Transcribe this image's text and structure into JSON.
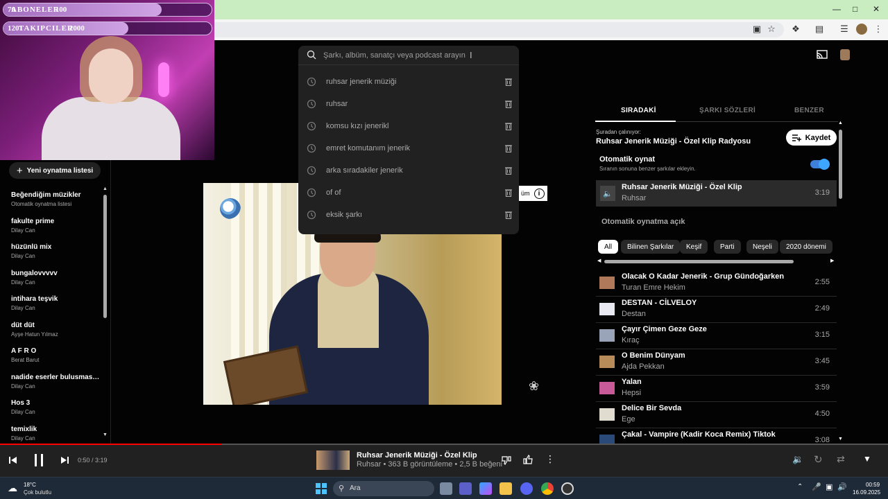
{
  "overlay": {
    "bars": [
      {
        "left": "76",
        "label": "ABONELER",
        "right": "100",
        "progress": 0.76
      },
      {
        "left": "1201",
        "label": "TAKIPCILER",
        "right": "2000",
        "progress": 0.6
      }
    ]
  },
  "sidebar": {
    "new_playlist_label": "Yeni oynatma listesi",
    "items": [
      {
        "title": "Beğendiğim müzikler",
        "subtitle": "Otomatik oynatma listesi"
      },
      {
        "title": "fakulte prime",
        "subtitle": "Dilay Can"
      },
      {
        "title": "hüzünlü mix",
        "subtitle": "Dilay Can"
      },
      {
        "title": "bungalovvvvv",
        "subtitle": "Dilay Can"
      },
      {
        "title": "intihara teşvik",
        "subtitle": "Dilay Can"
      },
      {
        "title": "düt düt",
        "subtitle": "Ayşe Hatun Yılmaz"
      },
      {
        "title": "A F R O",
        "subtitle": "Berat Barut"
      },
      {
        "title": "nadide eserler bulusmasii...",
        "subtitle": "Dilay Can"
      },
      {
        "title": "Hos 3",
        "subtitle": "Dilay Can"
      },
      {
        "title": "temixlik",
        "subtitle": "Dilay Can"
      }
    ]
  },
  "search": {
    "placeholder": "Şarkı, albüm, sanatçı veya podcast arayın",
    "suggestions": [
      "ruhsar jenerik müziği",
      "ruhsar",
      "komsu kızı jenerikl",
      "emret komutanım jenerik",
      "arka sıradakiler jenerik",
      "of of",
      "eksik şarkı"
    ]
  },
  "video": {
    "info_text": "üm"
  },
  "right_panel": {
    "tabs": [
      "SIRADAKİ",
      "ŞARKI SÖZLERİ",
      "BENZER"
    ],
    "from_label": "Şuradan çalınıyor:",
    "from_title": "Ruhsar Jenerik Müziği - Özel Klip Radyosu",
    "save_label": "Kaydet",
    "autoplay_title": "Otomatik oynat",
    "autoplay_sub": "Sıranın sonuna benzer şarkılar ekleyin.",
    "now_playing": {
      "title": "Ruhsar Jenerik Müziği - Özel Klip",
      "artist": "Ruhsar",
      "duration": "3:19"
    },
    "autoplay_on_label": "Otomatik oynatma açık",
    "chips": [
      "All",
      "Bilinen Şarkılar",
      "Keşif",
      "Parti",
      "Neşeli",
      "2020 dönemi"
    ],
    "queue": [
      {
        "title": "Olacak O Kadar Jenerik - Grup Gündoğarken",
        "artist": "Turan Emre Hekim",
        "duration": "2:55"
      },
      {
        "title": "DESTAN - CİLVELOY",
        "artist": "Destan",
        "duration": "2:49"
      },
      {
        "title": "Çayır Çimen Geze Geze",
        "artist": "Kıraç",
        "duration": "3:15"
      },
      {
        "title": "O Benim Dünyam",
        "artist": "Ajda Pekkan",
        "duration": "3:45"
      },
      {
        "title": "Yalan",
        "artist": "Hepsi",
        "duration": "3:59"
      },
      {
        "title": "Delice Bir Sevda",
        "artist": "Ege",
        "duration": "4:50"
      },
      {
        "title": "Çakal - Vampire (Kadir Koca Remix) Tiktok",
        "artist": "",
        "duration": "3:08"
      }
    ]
  },
  "player": {
    "time": "0:50 / 3:19",
    "progress": 0.25,
    "title": "Ruhsar Jenerik Müziği - Özel Klip",
    "subtitle": "Ruhsar • 363 B görüntüleme • 2,5 B beğeni"
  },
  "taskbar": {
    "weather_temp": "18°C",
    "weather_desc": "Çok bulutlu",
    "search_label": "Ara",
    "time": "00:59",
    "date": "16.09.2025"
  },
  "colors": {
    "accent": "#3ea6ff",
    "progress": "#ff0000",
    "bg": "#030303"
  }
}
